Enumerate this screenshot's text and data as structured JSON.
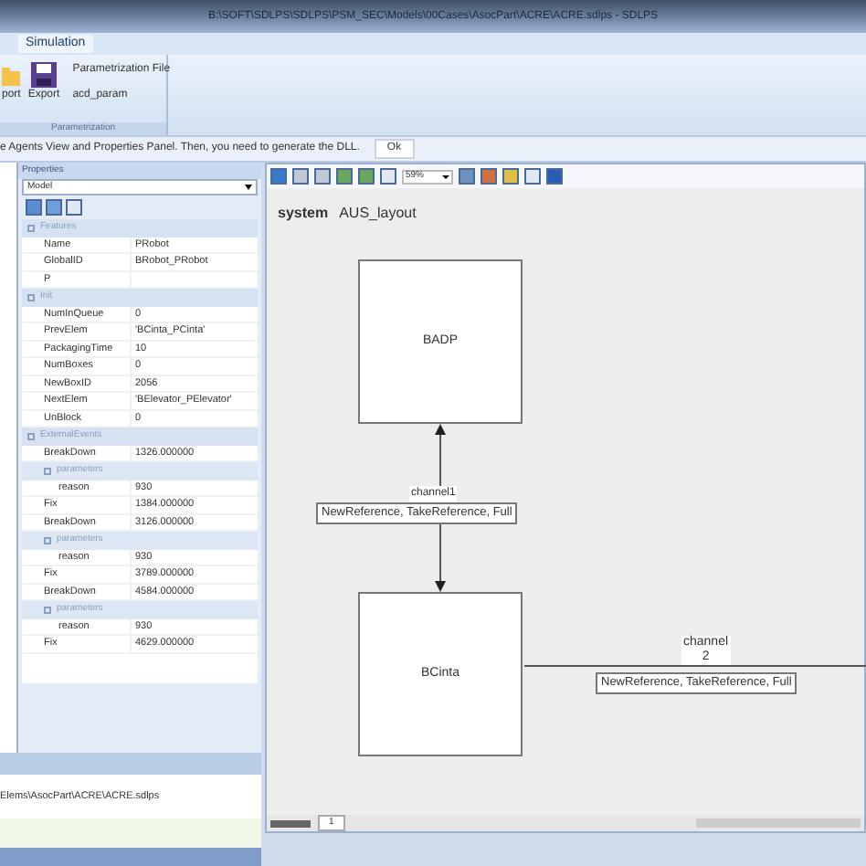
{
  "window": {
    "title": "B:\\SOFT\\SDLPS\\SDLPS\\PSM_SEC\\Models\\00Cases\\AsocPart\\ACRE\\ACRE.sdlps - SDLPS"
  },
  "ribbon": {
    "tabs": [
      {
        "label": "Simulation",
        "selected": true
      }
    ],
    "buttons": [
      {
        "label": "port"
      },
      {
        "label": "Export"
      }
    ],
    "links": [
      "Parametrization File",
      "acd_param"
    ],
    "group_label": "Parametrization"
  },
  "message": {
    "text": "e Agents View and Properties Panel. Then, you need to generate the DLL.",
    "button": "Ok"
  },
  "properties": {
    "title": "Properties",
    "object": "Model",
    "categories": [
      {
        "name": "Features",
        "rows": [
          {
            "name": "Name",
            "value": "PRobot"
          },
          {
            "name": "GlobalID",
            "value": "BRobot_PRobot"
          },
          {
            "name": "P",
            "value": ""
          }
        ]
      },
      {
        "name": "Init",
        "rows": [
          {
            "name": "NumInQueue",
            "value": "0"
          },
          {
            "name": "PrevElem",
            "value": "'BCinta_PCinta'"
          },
          {
            "name": "PackagingTime",
            "value": "10"
          },
          {
            "name": "NumBoxes",
            "value": "0"
          },
          {
            "name": "NewBoxID",
            "value": "2056"
          },
          {
            "name": "NextElem",
            "value": "'BElevator_PElevator'"
          },
          {
            "name": "UnBlock",
            "value": "0"
          }
        ]
      },
      {
        "name": "ExternalEvents",
        "rows": [
          {
            "name": "BreakDown",
            "value": "1326.000000"
          },
          {
            "name": "parameters",
            "kind": "group"
          },
          {
            "name": "reason",
            "value": "930",
            "kind": "param"
          },
          {
            "name": "Fix",
            "value": "1384.000000"
          },
          {
            "name": "BreakDown",
            "value": "3126.000000"
          },
          {
            "name": "parameters",
            "kind": "group"
          },
          {
            "name": "reason",
            "value": "930",
            "kind": "param"
          },
          {
            "name": "Fix",
            "value": "3789.000000"
          },
          {
            "name": "BreakDown",
            "value": "4584.000000"
          },
          {
            "name": "parameters",
            "kind": "group"
          },
          {
            "name": "reason",
            "value": "930",
            "kind": "param"
          },
          {
            "name": "Fix",
            "value": "4629.000000"
          }
        ]
      }
    ]
  },
  "output": {
    "text": "Elems\\AsocPart\\ACRE\\ACRE.sdlps"
  },
  "diagram": {
    "zoom": "59%",
    "system_label": "system",
    "system_name": "AUS_layout",
    "nodes": [
      {
        "name": "BADP"
      },
      {
        "name": "BCinta"
      }
    ],
    "channels": [
      {
        "name": "channel1",
        "events": "NewReference, TakeReference, Full"
      },
      {
        "name": "channel",
        "number": "2",
        "events": "NewReference, TakeReference, Full"
      }
    ],
    "sheet_tab": "1"
  }
}
